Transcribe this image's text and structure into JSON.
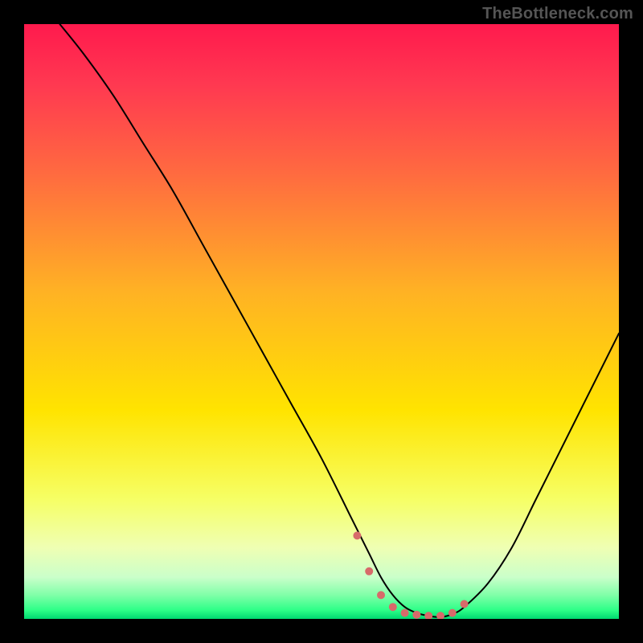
{
  "watermark": "TheBottleneck.com",
  "chart_data": {
    "type": "line",
    "title": "",
    "xlabel": "",
    "ylabel": "",
    "xlim": [
      0,
      100
    ],
    "ylim": [
      0,
      100
    ],
    "grid": false,
    "legend": false,
    "gradient_stops": [
      {
        "offset": 0.0,
        "color": "#ff1a4d"
      },
      {
        "offset": 0.1,
        "color": "#ff3851"
      },
      {
        "offset": 0.25,
        "color": "#ff6a40"
      },
      {
        "offset": 0.45,
        "color": "#ffb224"
      },
      {
        "offset": 0.65,
        "color": "#ffe400"
      },
      {
        "offset": 0.8,
        "color": "#f6ff66"
      },
      {
        "offset": 0.88,
        "color": "#efffb3"
      },
      {
        "offset": 0.93,
        "color": "#caffca"
      },
      {
        "offset": 0.96,
        "color": "#80ffa8"
      },
      {
        "offset": 0.985,
        "color": "#2eff88"
      },
      {
        "offset": 1.0,
        "color": "#00d870"
      }
    ],
    "series": [
      {
        "name": "curve",
        "stroke": "#000000",
        "stroke_width": 2,
        "x": [
          6,
          10,
          15,
          20,
          25,
          30,
          35,
          40,
          45,
          50,
          55,
          58,
          60,
          62,
          64,
          66,
          68,
          70,
          72,
          74,
          78,
          82,
          86,
          90,
          94,
          98,
          100
        ],
        "y": [
          100,
          95,
          88,
          80,
          72,
          63,
          54,
          45,
          36,
          27,
          17,
          11,
          7,
          4,
          2,
          1,
          0.5,
          0.3,
          0.8,
          2,
          6,
          12,
          20,
          28,
          36,
          44,
          48
        ]
      },
      {
        "name": "highlight_points",
        "type": "scatter",
        "color": "#d76a6a",
        "radius": 5,
        "x": [
          56,
          58,
          60,
          62,
          64,
          66,
          68,
          70,
          72,
          74
        ],
        "y": [
          14,
          8,
          4,
          2,
          1,
          0.7,
          0.5,
          0.5,
          1,
          2.5
        ]
      }
    ]
  }
}
